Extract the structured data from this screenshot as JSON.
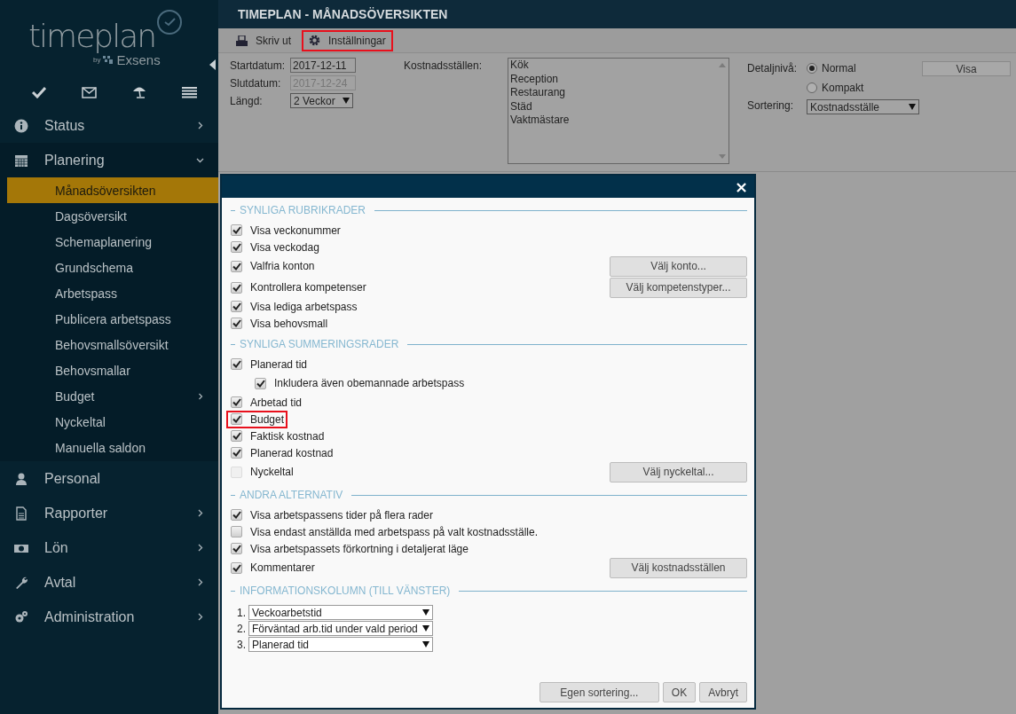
{
  "logo": {
    "name": "timeplan",
    "by": "by",
    "brand": "Exsens"
  },
  "sidebar": {
    "items": [
      {
        "label": "Status",
        "kind": "group",
        "expanded": false
      },
      {
        "label": "Planering",
        "kind": "group",
        "expanded": true,
        "children": [
          {
            "label": "Månadsöversikten",
            "kind": "link",
            "selected": true
          },
          {
            "label": "Dagsöversikt",
            "kind": "link",
            "selected": false
          },
          {
            "label": "Schemaplanering",
            "kind": "link",
            "selected": false
          },
          {
            "label": "Grundschema",
            "kind": "link",
            "selected": false
          },
          {
            "label": "Arbetspass",
            "kind": "link",
            "selected": false
          },
          {
            "label": "Publicera arbetspass",
            "kind": "link",
            "selected": false
          },
          {
            "label": "Behovsmallsöversikt",
            "kind": "link",
            "selected": false
          },
          {
            "label": "Behovsmallar",
            "kind": "link",
            "selected": false
          },
          {
            "label": "Budget",
            "kind": "group",
            "selected": false
          },
          {
            "label": "Nyckeltal",
            "kind": "link",
            "selected": false
          },
          {
            "label": "Manuella saldon",
            "kind": "link",
            "selected": false
          }
        ]
      },
      {
        "label": "Personal",
        "kind": "link"
      },
      {
        "label": "Rapporter",
        "kind": "group",
        "expanded": false
      },
      {
        "label": "Lön",
        "kind": "group",
        "expanded": false
      },
      {
        "label": "Avtal",
        "kind": "group",
        "expanded": false
      },
      {
        "label": "Administration",
        "kind": "group",
        "expanded": false
      }
    ]
  },
  "header": {
    "title": "TIMEPLAN - MÅNADSÖVERSIKTEN"
  },
  "toolbar": [
    {
      "label": "Skriv ut",
      "highlighted": false
    },
    {
      "label": "Inställningar",
      "highlighted": true
    }
  ],
  "filters": {
    "start_label": "Startdatum:",
    "start_value": "2017-12-11",
    "end_label": "Slutdatum:",
    "end_value": "2017-12-24",
    "length_label": "Längd:",
    "length_value": "2 Veckor",
    "cost_label": "Kostnadsställen:",
    "cost_centers": [
      "Kök",
      "Reception",
      "Restaurang",
      "Städ",
      "Vaktmästare"
    ],
    "detail_label": "Detaljnivå:",
    "detail_options": [
      {
        "label": "Normal",
        "selected": true
      },
      {
        "label": "Kompakt",
        "selected": false
      }
    ],
    "sort_label": "Sortering:",
    "sort_value": "Kostnadsställe",
    "show_button": "Visa"
  },
  "dialog": {
    "close": "×",
    "sections": [
      {
        "title": "SYNLIGA RUBRIKRADER",
        "kind": "checks",
        "items": [
          {
            "label": "Visa veckonummer",
            "checked": true,
            "disabled": false,
            "highlighted": false
          },
          {
            "label": "Visa veckodag",
            "checked": true,
            "disabled": false,
            "highlighted": false
          },
          {
            "label": "Valfria konton",
            "checked": true,
            "disabled": false,
            "highlighted": false,
            "button": "Välj konto..."
          },
          {
            "label": "Kontrollera kompetenser",
            "checked": true,
            "disabled": false,
            "highlighted": false,
            "button": "Välj kompetenstyper..."
          },
          {
            "label": "Visa lediga arbetspass",
            "checked": true,
            "disabled": false,
            "highlighted": false
          },
          {
            "label": "Visa behovsmall",
            "checked": true,
            "disabled": false,
            "highlighted": false
          }
        ]
      },
      {
        "title": "SYNLIGA SUMMERINGSRADER",
        "kind": "checks",
        "items": [
          {
            "label": "Planerad tid",
            "checked": true,
            "disabled": false,
            "highlighted": false,
            "children": [
              {
                "label": "Inkludera även obemannade arbetspass",
                "checked": true,
                "disabled": false,
                "highlighted": false
              }
            ]
          },
          {
            "label": "Arbetad tid",
            "checked": true,
            "disabled": false,
            "highlighted": false
          },
          {
            "label": "Budget",
            "checked": true,
            "disabled": false,
            "highlighted": true
          },
          {
            "label": "Faktisk kostnad",
            "checked": true,
            "disabled": false,
            "highlighted": false
          },
          {
            "label": "Planerad kostnad",
            "checked": true,
            "disabled": false,
            "highlighted": false
          },
          {
            "label": "Nyckeltal",
            "checked": false,
            "disabled": true,
            "highlighted": false,
            "button": "Välj nyckeltal..."
          }
        ]
      },
      {
        "title": "ANDRA ALTERNATIV",
        "kind": "checks",
        "items": [
          {
            "label": "Visa arbetspassens tider på flera rader",
            "checked": true,
            "disabled": false,
            "highlighted": false
          },
          {
            "label": "Visa endast anställda med arbetspass på valt kostnadsställe.",
            "checked": false,
            "disabled": false,
            "highlighted": false
          },
          {
            "label": "Visa arbetspassets förkortning i detaljerat läge",
            "checked": true,
            "disabled": false,
            "highlighted": false
          },
          {
            "label": "Kommentarer",
            "checked": true,
            "disabled": false,
            "highlighted": false,
            "button": "Välj kostnadsställen"
          }
        ]
      },
      {
        "title": "INFORMATIONSKOLUMN (TILL VÄNSTER)",
        "kind": "selects",
        "items": [
          {
            "number": "1.",
            "value": "Veckoarbetstid"
          },
          {
            "number": "2.",
            "value": "Förväntad arb.tid under vald period"
          },
          {
            "number": "3.",
            "value": "Planerad tid"
          }
        ]
      }
    ],
    "buttons": [
      "Egen sortering...",
      "OK",
      "Avbryt"
    ]
  }
}
